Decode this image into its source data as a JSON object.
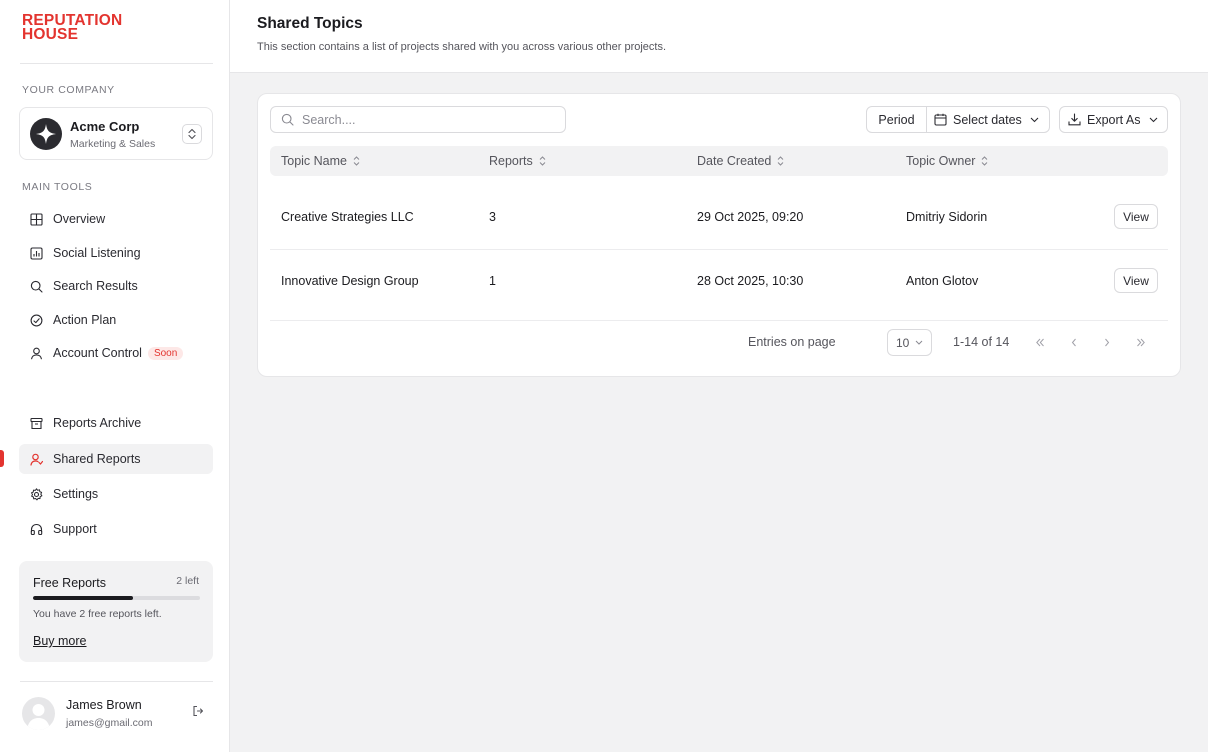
{
  "brand": {
    "line1": "REPUTATION",
    "line2": "HOUSE",
    "color": "#e3342f"
  },
  "sidebar": {
    "company_section": "YOUR COMPANY",
    "company": {
      "name": "Acme Corp",
      "subtitle": "Marketing & Sales",
      "avatar_icon": "sparkle-logo-icon",
      "switch_icon": "chevron-up-down-icon"
    },
    "tools_section": "MAIN TOOLS",
    "main_items": [
      {
        "label": "Overview",
        "icon": "grid-icon"
      },
      {
        "label": "Social Listening",
        "icon": "bar-chart-icon"
      },
      {
        "label": "Search Results",
        "icon": "search-icon"
      },
      {
        "label": "Action Plan",
        "icon": "check-circle-icon"
      },
      {
        "label": "Account Control",
        "icon": "user-icon",
        "badge": "Soon"
      }
    ],
    "secondary_items": [
      {
        "label": "Reports Archive",
        "icon": "archive-icon"
      },
      {
        "label": "Shared Reports",
        "icon": "user-share-icon",
        "active": true
      },
      {
        "label": "Settings",
        "icon": "gear-icon"
      },
      {
        "label": "Support",
        "icon": "headphones-icon"
      }
    ],
    "free_reports": {
      "title": "Free Reports",
      "left_label": "2 left",
      "progress": 0.6,
      "description": "You have 2 free reports left.",
      "buy_label": "Buy more"
    },
    "user": {
      "name": "James Brown",
      "email": "james@gmail.com",
      "logout_icon": "logout-icon"
    }
  },
  "header": {
    "title": "Shared Topics",
    "subtitle": "This section contains a list of projects shared with you across various other projects."
  },
  "toolbar": {
    "search_placeholder": "Search....",
    "period_label": "Period",
    "dates_label": "Select dates",
    "export_label": "Export As"
  },
  "table": {
    "columns": [
      "Topic Name",
      "Reports",
      "Date Created",
      "Topic Owner"
    ],
    "rows": [
      {
        "topic": "Creative Strategies LLC",
        "reports": "3",
        "date": "29 Oct 2025, 09:20",
        "owner": "Dmitriy Sidorin",
        "action": "View"
      },
      {
        "topic": "Innovative Design Group",
        "reports": "1",
        "date": "28 Oct 2025, 10:30",
        "owner": "Anton Glotov",
        "action": "View"
      }
    ]
  },
  "pagination": {
    "entries_label": "Entries on page",
    "page_size": "10",
    "range": "1-14 of 14"
  }
}
